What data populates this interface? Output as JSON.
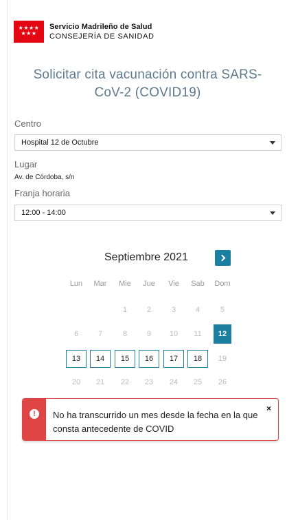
{
  "header": {
    "org_line1": "Servicio Madrileño de Salud",
    "org_line2": "CONSEJERÍA DE SANIDAD",
    "logo_stars": "★★★★ ★★★"
  },
  "title": "Solicitar cita vacunación contra SARS-CoV-2 (COVID19)",
  "form": {
    "centro_label": "Centro",
    "centro_value": "Hospital 12 de Octubre",
    "lugar_label": "Lugar",
    "lugar_value": "Av. de Córdoba, s/n",
    "franja_label": "Franja horaria",
    "franja_value": "12:00 - 14:00"
  },
  "calendar": {
    "month": "Septiembre 2021",
    "weekdays": [
      "Lun",
      "Mar",
      "Mie",
      "Jue",
      "Vie",
      "Sab",
      "Dom"
    ],
    "rows": [
      [
        "",
        "",
        "1",
        "2",
        "3",
        "4",
        "5"
      ],
      [
        "6",
        "7",
        "8",
        "9",
        "10",
        "11",
        "12"
      ],
      [
        "13",
        "14",
        "15",
        "16",
        "17",
        "18",
        "19"
      ],
      [
        "20",
        "21",
        "22",
        "23",
        "24",
        "25",
        "26"
      ]
    ],
    "selected_day": "12",
    "available_days": [
      "13",
      "14",
      "15",
      "16",
      "17",
      "18"
    ]
  },
  "alert": {
    "icon": "!",
    "message": "No ha transcurrido un mes desde la fecha en la que consta antecedente de COVID",
    "close": "×"
  },
  "colors": {
    "accent": "#1a7fa0",
    "error": "#e04545",
    "title": "#5e7a8d",
    "brand_red": "#e30613"
  }
}
